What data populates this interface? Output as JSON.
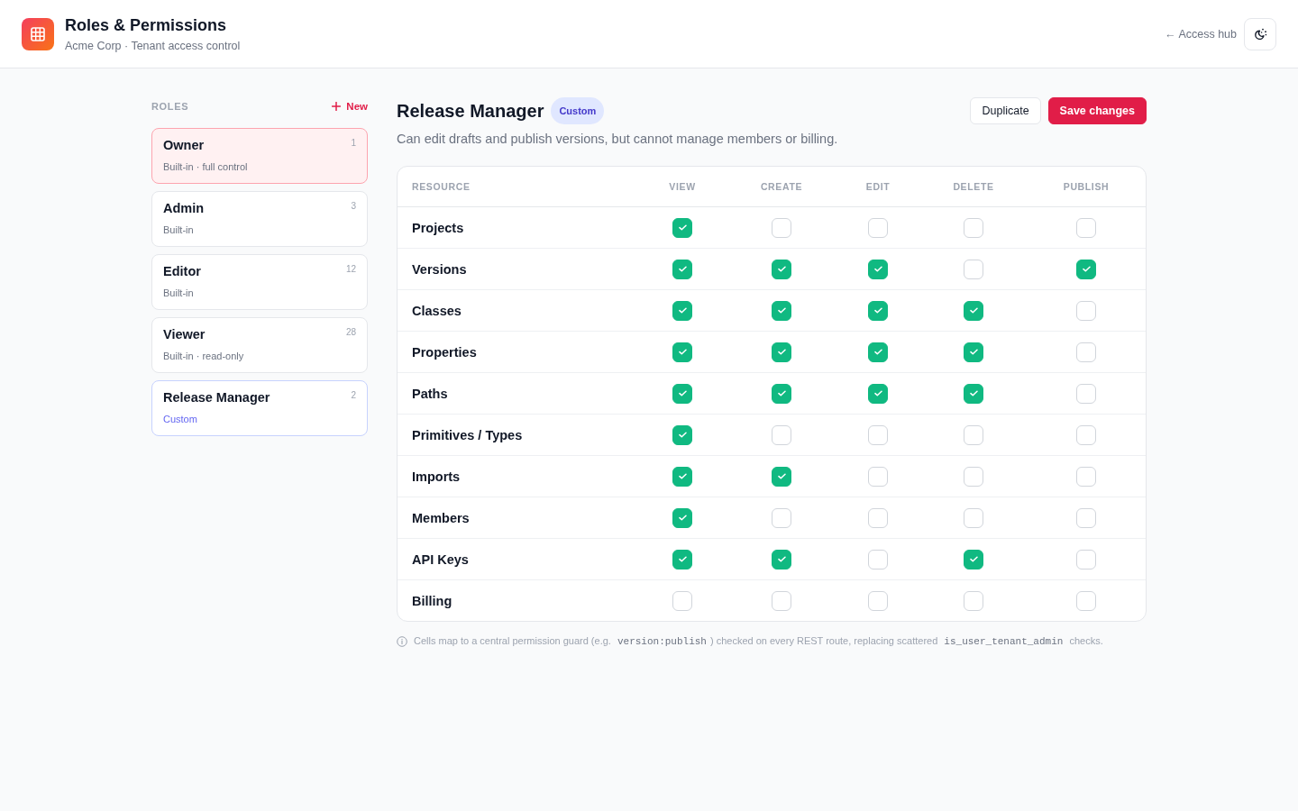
{
  "header": {
    "title": "Roles & Permissions",
    "subtitle": "Acme Corp · Tenant access control",
    "back_link": "← Access hub"
  },
  "sidebar": {
    "heading": "ROLES",
    "new_button": "New",
    "roles": [
      {
        "name": "Owner",
        "description": "Built-in · full control",
        "count": "1",
        "kind": "owner",
        "selected": false
      },
      {
        "name": "Admin",
        "description": "Built-in",
        "count": "3",
        "kind": "builtin",
        "selected": false
      },
      {
        "name": "Editor",
        "description": "Built-in",
        "count": "12",
        "kind": "builtin",
        "selected": false
      },
      {
        "name": "Viewer",
        "description": "Built-in · read-only",
        "count": "28",
        "kind": "builtin",
        "selected": false
      },
      {
        "name": "Release Manager",
        "description": "Custom",
        "count": "2",
        "kind": "custom",
        "selected": true
      }
    ]
  },
  "role_detail": {
    "title": "Release Manager",
    "badge": "Custom",
    "description": "Can edit drafts and publish versions, but cannot manage members or billing.",
    "buttons": [
      {
        "label": "Duplicate",
        "kind": "secondary"
      },
      {
        "label": "Save changes",
        "kind": "primary"
      }
    ]
  },
  "table": {
    "columns": [
      "RESOURCE",
      "VIEW",
      "CREATE",
      "EDIT",
      "DELETE",
      "PUBLISH"
    ],
    "rows": [
      {
        "resource": "Projects",
        "permissions": [
          {
            "checked": true
          },
          {
            "checked": false
          },
          {
            "checked": false
          },
          {
            "checked": false
          },
          {
            "checked": false
          }
        ]
      },
      {
        "resource": "Versions",
        "permissions": [
          {
            "checked": true
          },
          {
            "checked": true
          },
          {
            "checked": true
          },
          {
            "checked": false
          },
          {
            "checked": true
          }
        ]
      },
      {
        "resource": "Classes",
        "permissions": [
          {
            "checked": true
          },
          {
            "checked": true
          },
          {
            "checked": true
          },
          {
            "checked": true
          },
          {
            "checked": false
          }
        ]
      },
      {
        "resource": "Properties",
        "permissions": [
          {
            "checked": true
          },
          {
            "checked": true
          },
          {
            "checked": true
          },
          {
            "checked": true
          },
          {
            "checked": false
          }
        ]
      },
      {
        "resource": "Paths",
        "permissions": [
          {
            "checked": true
          },
          {
            "checked": true
          },
          {
            "checked": true
          },
          {
            "checked": true
          },
          {
            "checked": false
          }
        ]
      },
      {
        "resource": "Primitives / Types",
        "permissions": [
          {
            "checked": true
          },
          {
            "checked": false
          },
          {
            "checked": false
          },
          {
            "checked": false
          },
          {
            "checked": false
          }
        ]
      },
      {
        "resource": "Imports",
        "permissions": [
          {
            "checked": true
          },
          {
            "checked": true
          },
          {
            "checked": false
          },
          {
            "checked": false
          },
          {
            "checked": false
          }
        ]
      },
      {
        "resource": "Members",
        "permissions": [
          {
            "checked": true
          },
          {
            "checked": false
          },
          {
            "checked": false
          },
          {
            "checked": false
          },
          {
            "checked": false
          }
        ]
      },
      {
        "resource": "API Keys",
        "permissions": [
          {
            "checked": true
          },
          {
            "checked": true
          },
          {
            "checked": false
          },
          {
            "checked": true
          },
          {
            "checked": false
          }
        ]
      },
      {
        "resource": "Billing",
        "permissions": [
          {
            "checked": false
          },
          {
            "checked": false
          },
          {
            "checked": false
          },
          {
            "checked": false
          },
          {
            "checked": false
          }
        ]
      }
    ]
  },
  "footnote": [
    {
      "kind": "text",
      "text": "Cells map to a central permission guard (e.g. "
    },
    {
      "kind": "code",
      "text": "version:publish"
    },
    {
      "kind": "text",
      "text": ") checked on every REST route, replacing scattered "
    },
    {
      "kind": "code",
      "text": "is_user_tenant_admin"
    },
    {
      "kind": "text",
      "text": " checks."
    }
  ]
}
